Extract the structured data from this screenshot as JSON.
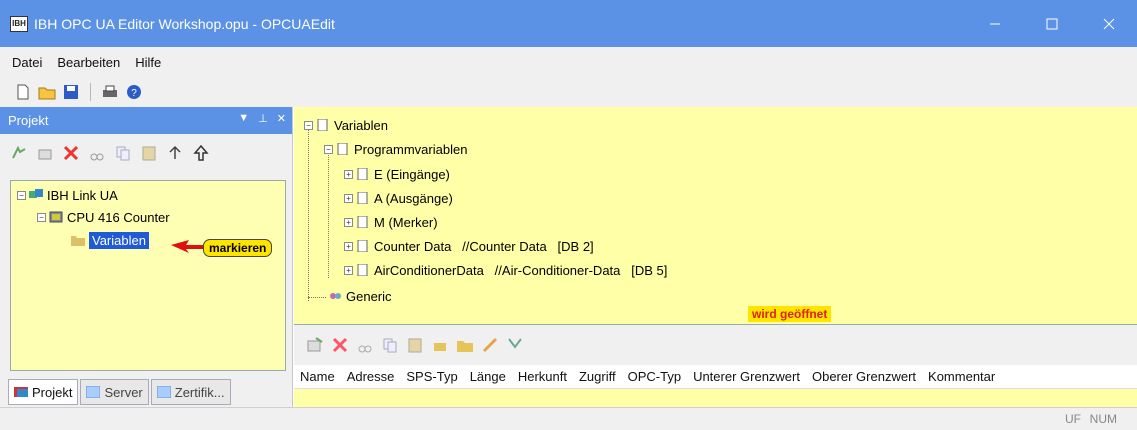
{
  "window": {
    "title": "IBH OPC UA Editor Workshop.opu - OPCUAEdit",
    "app_icon_text": "IBH"
  },
  "menu": [
    {
      "label": "Datei"
    },
    {
      "label": "Bearbeiten"
    },
    {
      "label": "Hilfe"
    }
  ],
  "toolbar": {
    "icons": [
      "new-file-icon",
      "open-folder-icon",
      "save-icon",
      "print-icon",
      "help-icon"
    ]
  },
  "left_panel": {
    "title": "Projekt",
    "tools": [
      "add-icon",
      "edit-icon",
      "delete-icon",
      "cut-icon",
      "copy-icon",
      "paste-icon",
      "up-arrow-icon",
      "up-level-icon"
    ],
    "tree": {
      "root": "IBH Link UA",
      "child": "CPU 416 Counter",
      "leaf": "Variablen"
    },
    "callout": "markieren",
    "tabs": [
      "Projekt",
      "Server",
      "Zertifik..."
    ]
  },
  "right_tree": {
    "root": "Variablen",
    "group": "Programmvariablen",
    "items": [
      "E (Eingänge)",
      "A (Ausgänge)",
      "M (Merker)",
      "Counter Data   //Counter Data   [DB 2]",
      "AirConditionerData   //Air-Conditioner-Data   [DB 5]"
    ],
    "generic": "Generic",
    "note": "wird geöffnet"
  },
  "grid": {
    "columns": [
      "Name",
      "Adresse",
      "SPS-Typ",
      "Länge",
      "Herkunft",
      "Zugriff",
      "OPC-Typ",
      "Unterer Grenzwert",
      "Oberer Grenzwert",
      "Kommentar"
    ]
  },
  "status": {
    "uf": "UF",
    "num": "NUM"
  }
}
